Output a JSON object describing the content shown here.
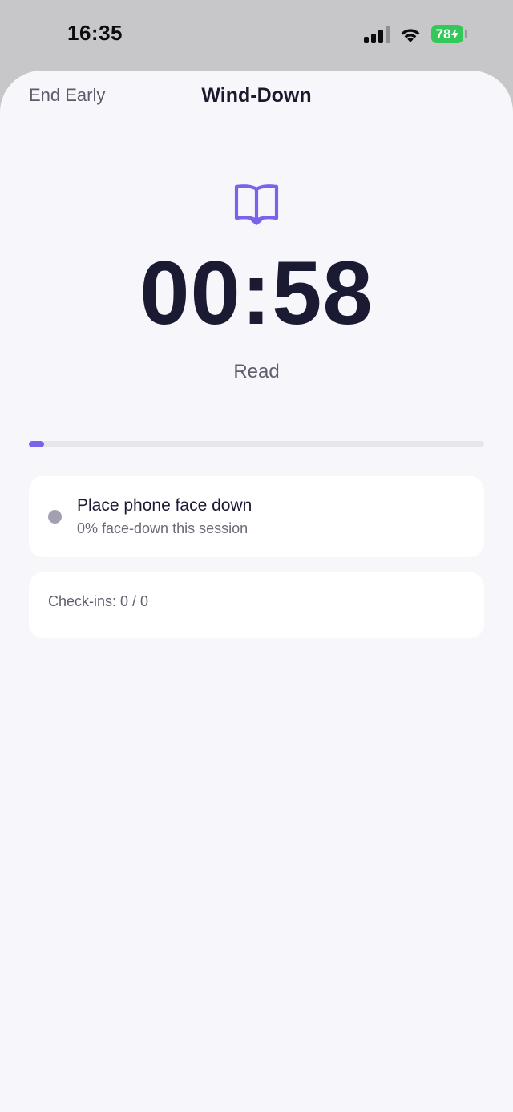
{
  "status_bar": {
    "time": "16:35",
    "battery_level": "78",
    "battery_charging": true,
    "signal_bars": 3,
    "signal_bars_total": 4
  },
  "nav": {
    "end_label": "End Early",
    "title": "Wind-Down"
  },
  "session": {
    "icon": "book-icon",
    "timer": "00:58",
    "activity": "Read",
    "progress_fraction": 0.033
  },
  "face_down": {
    "title": "Place phone face down",
    "subtitle": "0% face-down this session"
  },
  "checkins": {
    "text": "Check-ins: 0 / 0"
  },
  "colors": {
    "accent": "#7a63ea",
    "battery": "#34c759",
    "text_primary": "#1b1a33",
    "text_secondary": "#5e5e6e",
    "status_dot": "#a2a1b2"
  }
}
